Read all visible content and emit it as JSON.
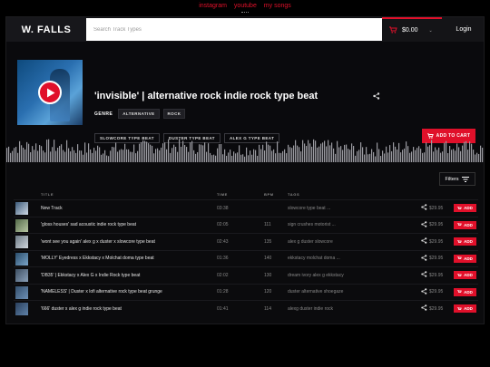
{
  "top_links": [
    "instagram",
    "youtube",
    "my songs"
  ],
  "header": {
    "logo": "W. FALLS",
    "search_placeholder": "Search Track Types",
    "cart_total": "$0.00",
    "login": "Login"
  },
  "hero": {
    "title": "'invisible' | alternative rock indie rock type beat",
    "genre_label": "GENRE",
    "genres": [
      "ALTERNATIVE",
      "ROCK"
    ],
    "types": [
      "SLOWCORE TYPE BEAT",
      "DUSTER TYPE BEAT",
      "ALEX G TYPE BEAT"
    ],
    "add_to_cart": "ADD TO CART"
  },
  "filters_label": "Filters",
  "table": {
    "headers": {
      "title": "TITLE",
      "time": "TIME",
      "bpm": "BPM",
      "tags": "TAGS"
    },
    "rows": [
      {
        "title": "New Track",
        "time": "03:38",
        "bpm": "",
        "tags": "slowcore type beat ...",
        "price": "$29.95",
        "add": "ADD"
      },
      {
        "title": "'gloss houses' sad acoustic indie rock type beat",
        "time": "02:05",
        "bpm": "111",
        "tags": "sign crushes motorist ...",
        "price": "$29.95",
        "add": "ADD"
      },
      {
        "title": "'wont see you again' alex g x duster x slowcore type beat",
        "time": "02:43",
        "bpm": "135",
        "tags": "alex g  duster  slowcore",
        "price": "$29.95",
        "add": "ADD"
      },
      {
        "title": "'MOLLY' Eyedress x Ekkstacy x Molchat doma type beat",
        "time": "01:36",
        "bpm": "140",
        "tags": "ekkstacy  molchat doma ...",
        "price": "$29.95",
        "add": "ADD"
      },
      {
        "title": "'DB35' | Ekkstacy x Alex G x Indie Rock type beat",
        "time": "02:02",
        "bpm": "130",
        "tags": "dream ivory  alex g  ekkstacy",
        "price": "$29.95",
        "add": "ADD"
      },
      {
        "title": "'NAMELESS' | Duster x lofi alternative rock type beat grunge",
        "time": "01:28",
        "bpm": "120",
        "tags": "duster  alternative  shoegaze",
        "price": "$29.95",
        "add": "ADD"
      },
      {
        "title": "'666' duster x alex g indie rock type beat",
        "time": "01:41",
        "bpm": "114",
        "tags": "alexg  duster  indie rock",
        "price": "$29.95",
        "add": "ADD"
      }
    ]
  },
  "colors": {
    "accent": "#e0102a",
    "background": "#0b0b0d"
  }
}
